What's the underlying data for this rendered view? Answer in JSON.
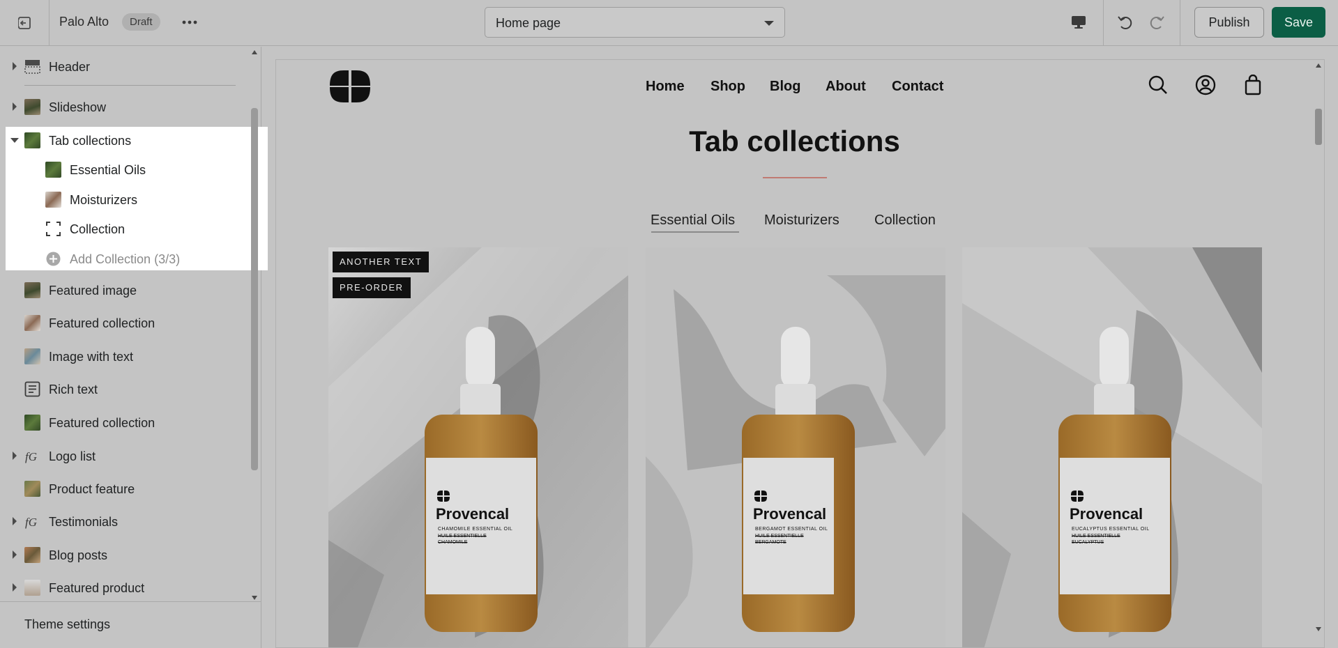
{
  "topbar": {
    "store_name": "Palo Alto",
    "status_badge": "Draft",
    "page_selector_value": "Home page",
    "publish_label": "Publish",
    "save_label": "Save",
    "colors": {
      "save_bg": "#0b5e45",
      "save_text": "#e9f3ef"
    }
  },
  "sidebar": {
    "sections": [
      {
        "label": "Header",
        "expandable": true
      },
      {
        "label": "Slideshow",
        "expandable": true
      },
      {
        "label": "Tab collections",
        "expandable": true,
        "expanded": true,
        "blocks": [
          {
            "label": "Essential Oils"
          },
          {
            "label": "Moisturizers"
          },
          {
            "label": "Collection"
          },
          {
            "label": "Add Collection (3/3)",
            "disabled": true
          }
        ]
      },
      {
        "label": "Featured image",
        "expandable": false
      },
      {
        "label": "Featured collection",
        "expandable": false
      },
      {
        "label": "Image with text",
        "expandable": false
      },
      {
        "label": "Rich text",
        "expandable": false
      },
      {
        "label": "Featured collection",
        "expandable": false
      },
      {
        "label": "Logo list",
        "expandable": true
      },
      {
        "label": "Product feature",
        "expandable": false
      },
      {
        "label": "Testimonials",
        "expandable": true
      },
      {
        "label": "Blog posts",
        "expandable": true
      },
      {
        "label": "Featured product",
        "expandable": true
      }
    ],
    "theme_settings": "Theme settings"
  },
  "preview": {
    "nav": [
      "Home",
      "Shop",
      "Blog",
      "About",
      "Contact"
    ],
    "section_title": "Tab collections",
    "tabs": [
      "Essential Oils",
      "Moisturizers",
      "Collection"
    ],
    "active_tab": "Essential Oils",
    "products": [
      {
        "badges": [
          "ANOTHER TEXT",
          "PRE-ORDER"
        ],
        "brand": "Provencal",
        "line1": "CHAMOMILE ESSENTIAL OIL",
        "line2": "HUILE ESSENTIELLE",
        "line3": "CHAMOMILE"
      },
      {
        "badges": [],
        "brand": "Provencal",
        "line1": "BERGAMOT ESSENTIAL OIL",
        "line2": "HUILE ESSENTIELLE",
        "line3": "BERGAMOTE"
      },
      {
        "badges": [],
        "brand": "Provencal",
        "line1": "EUCALYPTUS ESSENTIAL OIL",
        "line2": "HUILE ESSENTIELLE",
        "line3": "EUCALYPTUS"
      }
    ],
    "colors": {
      "title_rule": "#c07a72"
    }
  }
}
